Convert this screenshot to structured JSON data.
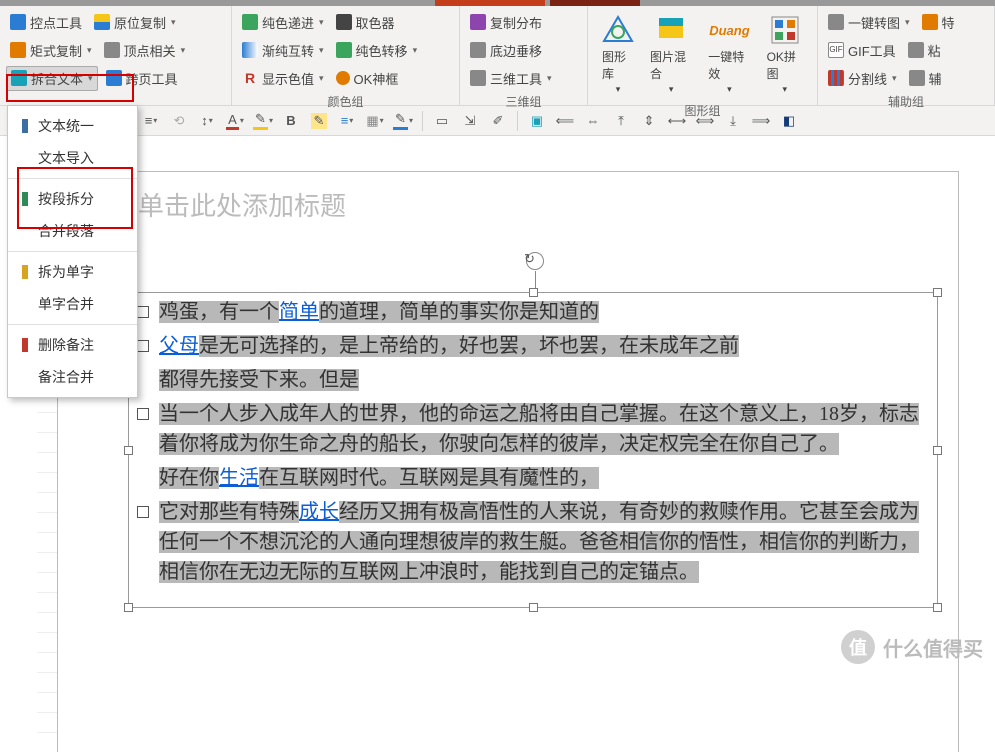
{
  "ribbon": {
    "g1": {
      "btn1": "控点工具",
      "btn2": "原位复制",
      "btn3": "矩式复制",
      "btn4": "顶点相关",
      "btn5": "拆合文本",
      "btn6": "跨页工具"
    },
    "g2": {
      "btn1": "纯色递进",
      "btn2": "取色器",
      "btn3": "渐纯互转",
      "btn4": "纯色转移",
      "btn5": "显示色值",
      "btn6": "OK神框",
      "label": "颜色组"
    },
    "g3": {
      "btn1": "复制分布",
      "btn2": "底边垂移",
      "btn3": "三维工具",
      "label": "三维组"
    },
    "g4": {
      "btn1": "图形库",
      "btn2": "图片混合",
      "btn3": "一键特效",
      "btn4": "OK拼图",
      "label": "图形组"
    },
    "g5": {
      "btn1": "一键转图",
      "btn2": "特",
      "btn3": "GIF工具",
      "btn4": "粘",
      "btn5": "分割线",
      "btn6": "辅",
      "label": "辅助组"
    }
  },
  "dropdown": {
    "i1": "文本统一",
    "i2": "文本导入",
    "i3": "按段拆分",
    "i4": "合并段落",
    "i5": "拆为单字",
    "i6": "单字合并",
    "i7": "删除备注",
    "i8": "备注合并"
  },
  "slide": {
    "title_placeholder": "单击此处添加标题",
    "p1a": "鸡蛋，有一个",
    "p1link": "简单",
    "p1b": "的道理，简单的事实你是知道的",
    "p2link": "父母",
    "p2b": "是无可选择的，是上帝给的，好也罢，坏也罢，在未成年之前",
    "p3": "都得先接受下来。但是",
    "p4": "当一个人步入成年人的世界，他的命运之船将由自己掌握。在这个意义上，18岁，标志着你将成为你生命之舟的船长，你驶向怎样的彼岸，决定权完全在你自己了。",
    "p5a": "好在你",
    "p5link": "生活",
    "p5b": "在互联网时代。互联网是具有魔性的，",
    "p6a": "它对那些有特殊",
    "p6link": "成长",
    "p6b": "经历又拥有极高悟性的人来说，有奇妙的救赎作用。它甚至会成为任何一个不想沉沦的人通向理想彼岸的救生艇。爸爸相信你的悟性，相信你的判断力，相信你在无边无际的互联网上冲浪时，能找到自己的定锚点。"
  },
  "watermark": {
    "text": "什么值得买",
    "badge": "值"
  }
}
